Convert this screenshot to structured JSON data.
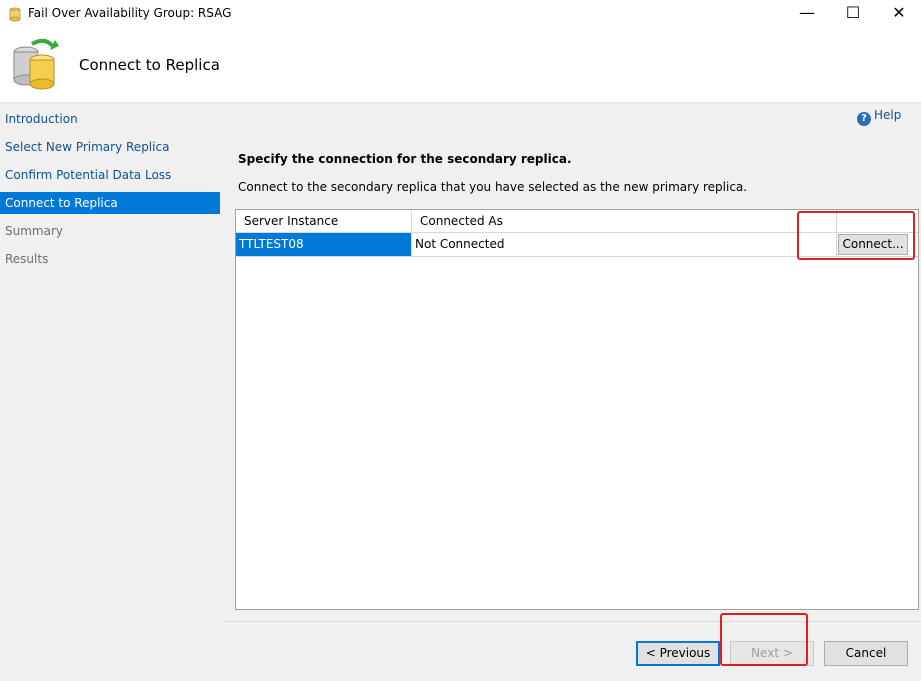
{
  "window": {
    "title": "Fail Over Availability Group: RSAG",
    "minimize": "—",
    "maximize": "☐",
    "close": "✕"
  },
  "header": {
    "title": "Connect to Replica"
  },
  "nav": {
    "items": [
      {
        "label": "Introduction",
        "state": "link"
      },
      {
        "label": "Select New Primary Replica",
        "state": "link"
      },
      {
        "label": "Confirm Potential Data Loss",
        "state": "link"
      },
      {
        "label": "Connect to Replica",
        "state": "active"
      },
      {
        "label": "Summary",
        "state": "disabled"
      },
      {
        "label": "Results",
        "state": "disabled"
      }
    ]
  },
  "help": {
    "label": "Help",
    "icon": "?"
  },
  "main": {
    "heading": "Specify the connection for the secondary replica.",
    "description": "Connect to the secondary replica that you have selected as the new primary replica.",
    "grid": {
      "columns": [
        "Server Instance",
        "Connected As"
      ],
      "rows": [
        {
          "server_instance": "TTLTEST08",
          "connected_as": "Not Connected",
          "action": "Connect..."
        }
      ]
    }
  },
  "footer": {
    "previous": "< Previous",
    "next": "Next >",
    "cancel": "Cancel"
  },
  "colors": {
    "accent": "#0078d7",
    "link": "#0b5394",
    "highlight": "#e02020"
  }
}
